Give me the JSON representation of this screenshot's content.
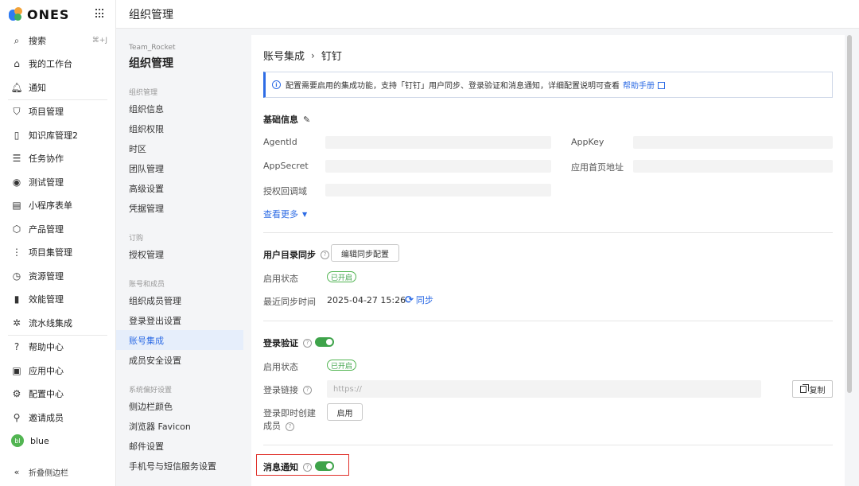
{
  "brand": {
    "name": "ONES"
  },
  "sidebar": {
    "items": [
      {
        "icon": "search-icon",
        "glyph": "⌕",
        "label": "搜索",
        "shortcut": "⌘+J"
      },
      {
        "icon": "home-icon",
        "glyph": "⌂",
        "label": "我的工作台"
      },
      {
        "icon": "bell-icon",
        "glyph": "🔔︎",
        "label": "通知"
      },
      {
        "icon": "project-icon",
        "glyph": "⛉",
        "label": "项目管理"
      },
      {
        "icon": "wiki-icon",
        "glyph": "▯",
        "label": "知识库管理2"
      },
      {
        "icon": "task-icon",
        "glyph": "☰",
        "label": "任务协作"
      },
      {
        "icon": "test-icon",
        "glyph": "◉",
        "label": "测试管理"
      },
      {
        "icon": "form-icon",
        "glyph": "▤",
        "label": "小程序表单"
      },
      {
        "icon": "product-icon",
        "glyph": "⬡",
        "label": "产品管理"
      },
      {
        "icon": "portfolio-icon",
        "glyph": "⋮",
        "label": "项目集管理"
      },
      {
        "icon": "resource-icon",
        "glyph": "◷",
        "label": "资源管理"
      },
      {
        "icon": "performance-icon",
        "glyph": "▮",
        "label": "效能管理"
      },
      {
        "icon": "pipeline-icon",
        "glyph": "✲",
        "label": "流水线集成"
      },
      {
        "icon": "help-center-icon",
        "glyph": "?",
        "label": "帮助中心"
      },
      {
        "icon": "app-center-icon",
        "glyph": "▣",
        "label": "应用中心"
      },
      {
        "icon": "config-icon",
        "glyph": "⚙",
        "label": "配置中心"
      },
      {
        "icon": "invite-icon",
        "glyph": "⚲",
        "label": "邀请成员"
      }
    ],
    "user": {
      "initials": "bl",
      "name": "blue"
    },
    "collapse": {
      "glyph": "«",
      "label": "折叠侧边栏"
    }
  },
  "header": {
    "title": "组织管理"
  },
  "submenu": {
    "team": "Team_Rocket",
    "title": "组织管理",
    "groups": [
      {
        "label": "组织管理",
        "items": [
          "组织信息",
          "组织权限",
          "时区",
          "团队管理",
          "高级设置",
          "凭据管理"
        ]
      },
      {
        "label": "订购",
        "items": [
          "授权管理"
        ]
      },
      {
        "label": "账号和成员",
        "items": [
          "组织成员管理",
          "登录登出设置",
          "账号集成",
          "成员安全设置"
        ]
      },
      {
        "label": "系统偏好设置",
        "items": [
          "侧边栏颜色",
          "浏览器 Favicon",
          "邮件设置",
          "手机号与短信服务设置"
        ]
      }
    ],
    "active": "账号集成"
  },
  "main": {
    "breadcrumb": {
      "parent": "账号集成",
      "separator": "›",
      "current": "钉钉"
    },
    "notice": {
      "text": "配置需要启用的集成功能，支持「钉钉」用户同步、登录验证和消息通知，详细配置说明可查看",
      "link": "帮助手册"
    },
    "basic": {
      "title": "基础信息",
      "fields": [
        "AgentId",
        "AppKey",
        "AppSecret",
        "应用首页地址",
        "授权回调域"
      ],
      "more": "查看更多"
    },
    "user_sync": {
      "title": "用户目录同步",
      "edit_button": "编辑同步配置",
      "status_label": "启用状态",
      "status_badge": "已开启",
      "last_sync_label": "最近同步时间",
      "last_sync_time": "2025-04-27 15:26",
      "sync_link": "同步"
    },
    "login": {
      "title": "登录验证",
      "status_label": "启用状态",
      "status_badge": "已开启",
      "link_label": "登录链接",
      "link_value": "https://",
      "copy_button": "复制",
      "create_label_line1": "登录即时创建",
      "create_label_line2": "成员",
      "enable_button": "启用"
    },
    "message": {
      "title": "消息通知"
    }
  },
  "colors": {
    "accent": "#2e6ce5",
    "success": "#3ea34a",
    "highlight": "#e0302a"
  }
}
